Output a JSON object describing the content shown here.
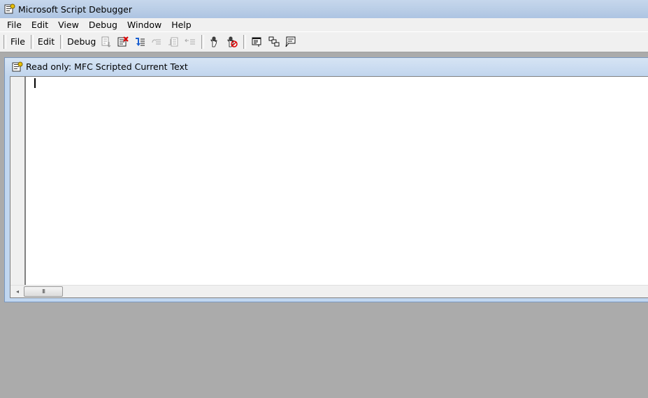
{
  "window": {
    "title": "Microsoft Script Debugger"
  },
  "menu": {
    "items": [
      "File",
      "Edit",
      "View",
      "Debug",
      "Window",
      "Help"
    ]
  },
  "toolbar": {
    "file_label": "File",
    "edit_label": "Edit",
    "debug_label": "Debug",
    "icons": [
      "run-icon",
      "stop-debugging-icon",
      "step-into-icon",
      "step-over-icon",
      "step-out-icon",
      "break-at-next-icon",
      "toggle-breakpoint-icon",
      "clear-breakpoints-icon",
      "running-documents-icon",
      "call-stack-icon",
      "command-window-icon"
    ]
  },
  "document": {
    "title": "Read only: MFC Scripted Current Text"
  },
  "scrollbar": {
    "thumb_grip": "III",
    "left_arrow": "◂"
  }
}
